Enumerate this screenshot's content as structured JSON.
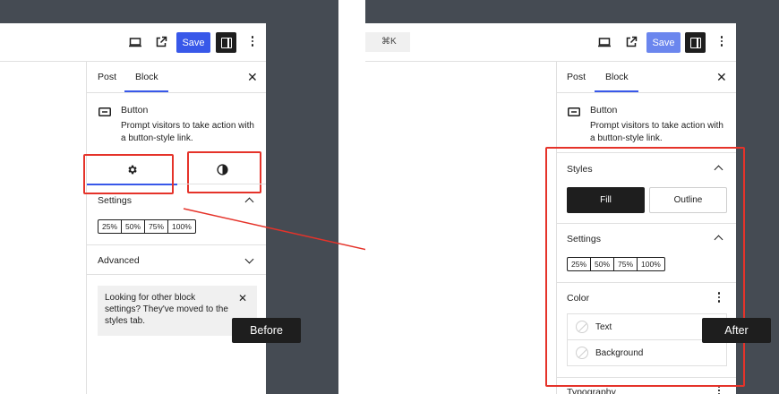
{
  "before": {
    "toolbar": {
      "save_label": "Save",
      "icons": [
        "laptop-icon",
        "external-link-icon",
        "sidebar-toggle-icon",
        "more-vertical-icon"
      ]
    },
    "sidebar": {
      "tabs": [
        "Post",
        "Block"
      ],
      "active_tab": "Block",
      "block": {
        "name": "Button",
        "description_line1": "Prompt visitors to take action with",
        "description_line2": "a button-style link."
      },
      "inspector_tabs": [
        "settings-gear",
        "styles-contrast"
      ],
      "settings_title": "Settings",
      "width_options": [
        "25%",
        "50%",
        "75%",
        "100%"
      ],
      "advanced_title": "Advanced",
      "notice": {
        "line1": "Looking for other block",
        "line2": "settings? They've moved to the",
        "line3": "styles tab."
      }
    },
    "label": "Before"
  },
  "after": {
    "toolbar": {
      "shortcut": "⌘K",
      "save_label": "Save"
    },
    "sidebar": {
      "tabs": [
        "Post",
        "Block"
      ],
      "active_tab": "Block",
      "block": {
        "name": "Button",
        "description_line1": "Prompt visitors to take action with",
        "description_line2": "a button-style link."
      },
      "styles_title": "Styles",
      "style_options": [
        "Fill",
        "Outline"
      ],
      "selected_style": "Fill",
      "settings_title": "Settings",
      "width_options": [
        "25%",
        "50%",
        "75%",
        "100%"
      ],
      "color_title": "Color",
      "color_items": [
        "Text",
        "Background"
      ],
      "typography_title": "Typography"
    },
    "label": "After"
  },
  "colors": {
    "accent": "#3858e9",
    "highlight": "#e5332a",
    "backdrop": "#454b53"
  }
}
